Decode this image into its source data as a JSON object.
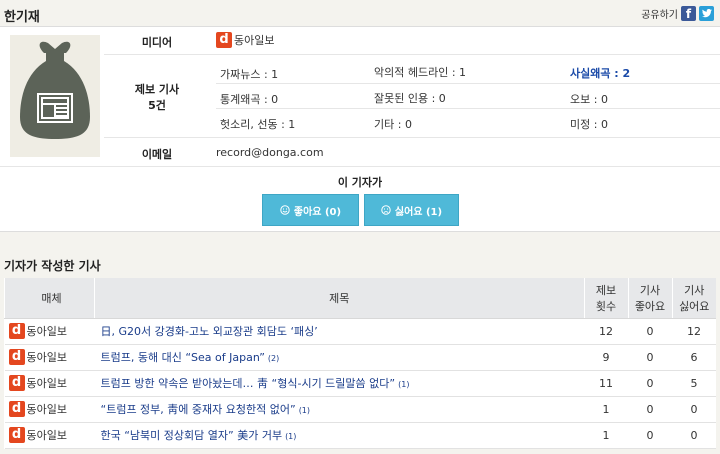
{
  "page": {
    "reporter_name": "한기재",
    "share_label": "공유하기"
  },
  "profile": {
    "media_label": "미디어",
    "media_name": "동아일보",
    "report_label": "제보 기사",
    "report_count": "5건",
    "categories": [
      {
        "text": "가짜뉴스 : 1"
      },
      {
        "text": "악의적 헤드라인 : 1"
      },
      {
        "text": "사실왜곡 : 2"
      },
      {
        "text": "통계왜곡 : 0"
      },
      {
        "text": "잘못된 인용 : 0"
      },
      {
        "text": "오보 : 0"
      },
      {
        "text": "헛소리, 선동 : 1"
      },
      {
        "text": "기타 : 0"
      },
      {
        "text": "미정 : 0"
      }
    ],
    "email_label": "이메일",
    "email": "record@donga.com"
  },
  "vote": {
    "title": "이 기자가",
    "like_label": "좋아요 (0)",
    "dislike_label": "싫어요 (1)"
  },
  "articles": {
    "title": "기자가 작성한 기사",
    "headers": {
      "media": "매체",
      "title": "제목",
      "reports": "제보\n횟수",
      "likes": "기사\n좋아요",
      "dislikes": "기사\n싫어요"
    },
    "rows": [
      {
        "media": "동아일보",
        "title": "日, G20서 강경화-고노 외교장관 회담도 ‘패싱’",
        "sup": "",
        "reports": "12",
        "likes": "0",
        "dislikes": "12"
      },
      {
        "media": "동아일보",
        "title": "트럼프, 동해 대신 “Sea of Japan”",
        "sup": "(2)",
        "reports": "9",
        "likes": "0",
        "dislikes": "6"
      },
      {
        "media": "동아일보",
        "title": "트럼프 방한 약속은 받아놨는데… 靑 “형식-시기 드릴말씀 없다”",
        "sup": "(1)",
        "reports": "11",
        "likes": "0",
        "dislikes": "5"
      },
      {
        "media": "동아일보",
        "title": "“트럼프 정부, 靑에 중재자 요청한적 없어”",
        "sup": "(1)",
        "reports": "1",
        "likes": "0",
        "dislikes": "0"
      },
      {
        "media": "동아일보",
        "title": "한국 “남북미 정상회담 열자” 美가 거부",
        "sup": "(1)",
        "reports": "1",
        "likes": "0",
        "dislikes": "0"
      }
    ]
  },
  "colors": {
    "accent": "#4fb9d8",
    "brand_logo": "#e4471f",
    "highlight": "#1a4aa8"
  }
}
